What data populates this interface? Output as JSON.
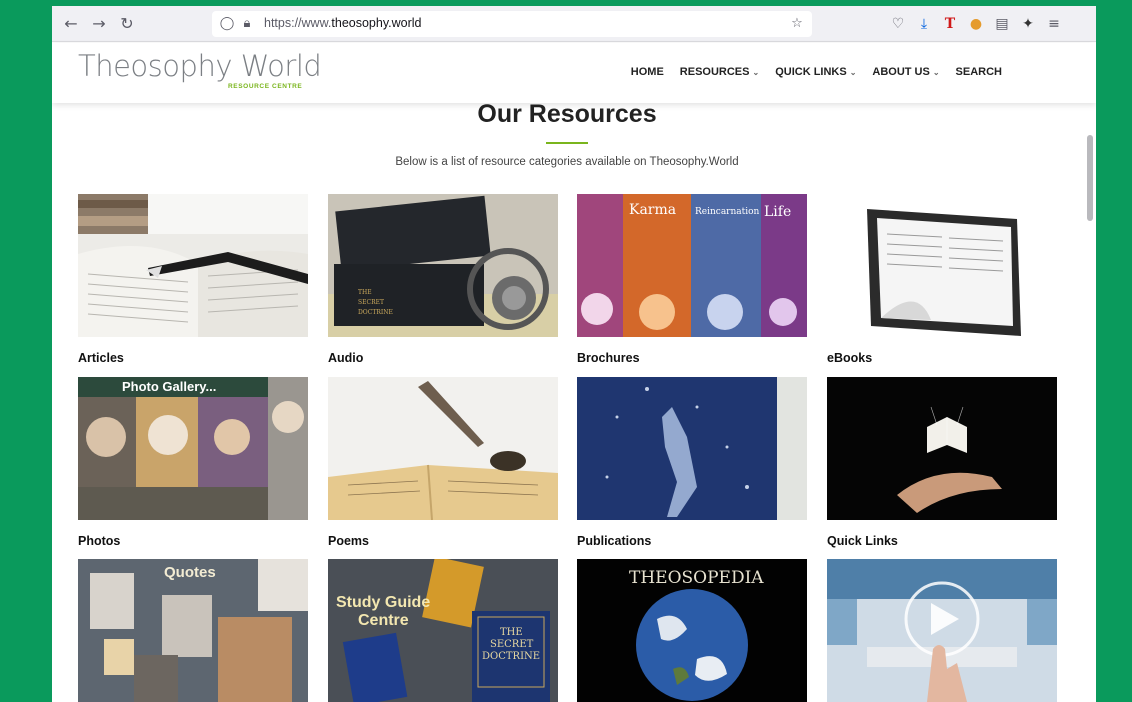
{
  "browser": {
    "url_prefix": "https://www.",
    "url_domain": "theosophy.world"
  },
  "site": {
    "logo": "Theosophy World",
    "logo_sub": "RESOURCE CENTRE",
    "menu": [
      {
        "label": "HOME"
      },
      {
        "label": "RESOURCES"
      },
      {
        "label": "QUICK LINKS"
      },
      {
        "label": "ABOUT US"
      },
      {
        "label": "SEARCH"
      }
    ]
  },
  "page": {
    "heading": "Our Resources",
    "intro": "Below is a list of resource categories available on Theosophy.World"
  },
  "resources": [
    {
      "label": "Articles"
    },
    {
      "label": "Audio"
    },
    {
      "label": "Brochures"
    },
    {
      "label": "eBooks"
    },
    {
      "label": "Photos"
    },
    {
      "label": "Poems"
    },
    {
      "label": "Publications"
    },
    {
      "label": "Quick Links"
    },
    {
      "label": ""
    },
    {
      "label": ""
    },
    {
      "label": ""
    },
    {
      "label": ""
    }
  ],
  "thumb_text": {
    "photos": "Photo Gallery...",
    "quotes": "Quotes",
    "study_guide_1": "Study Guide",
    "study_guide_2": "Centre",
    "secret_doctrine_1": "THE",
    "secret_doctrine_2": "SECRET",
    "secret_doctrine_3": "DOCTRINE",
    "theosopedia": "THEOSOPEDIA",
    "brochure_1": "Karma",
    "brochure_2": "Reincarnation",
    "brochure_3": "Life"
  },
  "colors": {
    "frame": "#0a9a5c",
    "accent": "#7ab51d"
  }
}
